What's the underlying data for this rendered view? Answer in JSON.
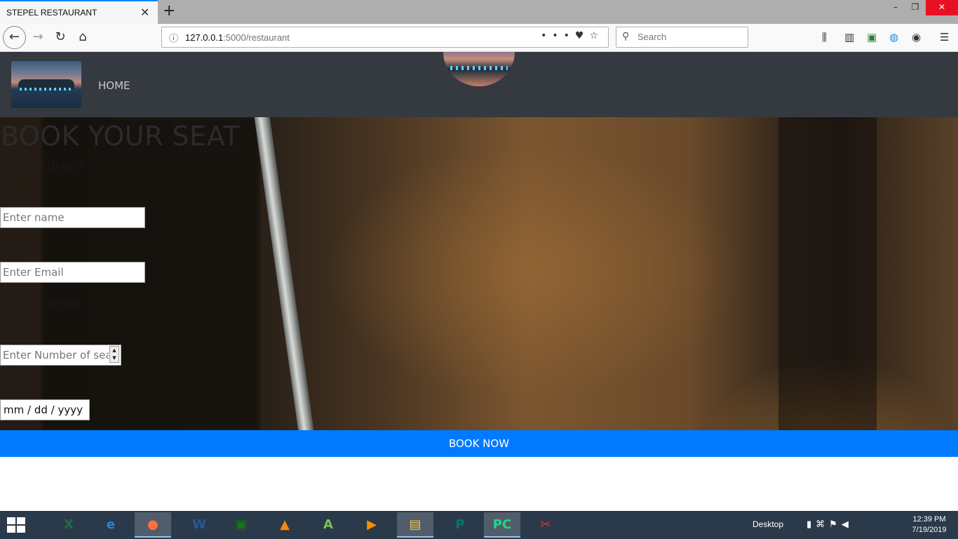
{
  "browser": {
    "tab_title": "STEPEL RESTAURANT",
    "tab_close": "✕",
    "new_tab": "+",
    "url_host": "127.0.0.1",
    "url_rest": ":5000/restaurant",
    "search_placeholder": "Search",
    "window_controls": {
      "minimize": "–",
      "restore": "❐",
      "close": "✕"
    }
  },
  "site": {
    "nav_home": "HOME",
    "heading": "BOOK YOUR SEAT",
    "security_section": "Security Details",
    "name_label": "Name:",
    "name_placeholder": "Enter name",
    "email_label": "Email:",
    "email_placeholder": "Enter Email",
    "booking_section": "Booking details",
    "table_label": "Table:",
    "table_placeholder": "Enter Number of seats",
    "date_label": "Date:",
    "date_value": "mm / dd / yyyy",
    "book_button": "BOOK NOW"
  },
  "taskbar": {
    "desktop_label": "Desktop",
    "time": "12:39 PM",
    "date": "7/19/2019",
    "apps": [
      {
        "name": "excel",
        "glyph": "X",
        "color": "#1d6f42"
      },
      {
        "name": "internet-explorer",
        "glyph": "e",
        "color": "#1e88e5"
      },
      {
        "name": "firefox",
        "glyph": "●",
        "color": "#ff7139"
      },
      {
        "name": "word",
        "glyph": "W",
        "color": "#2b579a"
      },
      {
        "name": "store",
        "glyph": "▣",
        "color": "#107c10"
      },
      {
        "name": "vlc",
        "glyph": "▲",
        "color": "#ff8800"
      },
      {
        "name": "android-studio",
        "glyph": "A",
        "color": "#78c257"
      },
      {
        "name": "media-player",
        "glyph": "▶",
        "color": "#ff8c00"
      },
      {
        "name": "file-explorer",
        "glyph": "▤",
        "color": "#f2c94c"
      },
      {
        "name": "publisher",
        "glyph": "P",
        "color": "#077568"
      },
      {
        "name": "pycharm",
        "glyph": "PC",
        "color": "#21d789"
      },
      {
        "name": "snipping-tool",
        "glyph": "✂",
        "color": "#d33"
      }
    ]
  }
}
